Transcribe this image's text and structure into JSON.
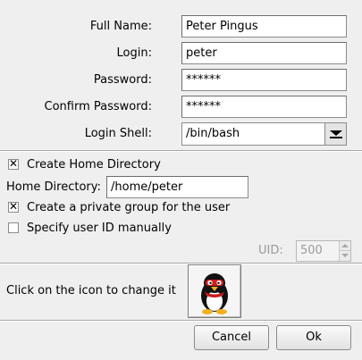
{
  "form": {
    "full_name_label": "Full Name:",
    "full_name_value": "Peter Pingus",
    "login_label": "Login:",
    "login_value": "peter",
    "password_label": "Password:",
    "password_value": "******",
    "confirm_label": "Confirm Password:",
    "confirm_value": "******",
    "shell_label": "Login Shell:",
    "shell_value": "/bin/bash"
  },
  "home": {
    "create_home_label": "Create Home Directory",
    "create_home_checked": true,
    "home_dir_label": "Home Directory:",
    "home_dir_value": "/home/peter",
    "private_group_label": "Create a private group for the user",
    "private_group_checked": true,
    "specify_uid_label": "Specify user ID manually",
    "specify_uid_checked": false,
    "uid_label": "UID:",
    "uid_value": "500"
  },
  "icon": {
    "hint": "Click on the icon to change it",
    "name": "penguin-avatar-icon"
  },
  "buttons": {
    "cancel": "Cancel",
    "ok": "Ok"
  },
  "glyphs": {
    "check": "✕"
  },
  "colors": {
    "background": "#efefef",
    "field_bg": "#ffffff",
    "disabled_text": "#9a9a9a"
  }
}
